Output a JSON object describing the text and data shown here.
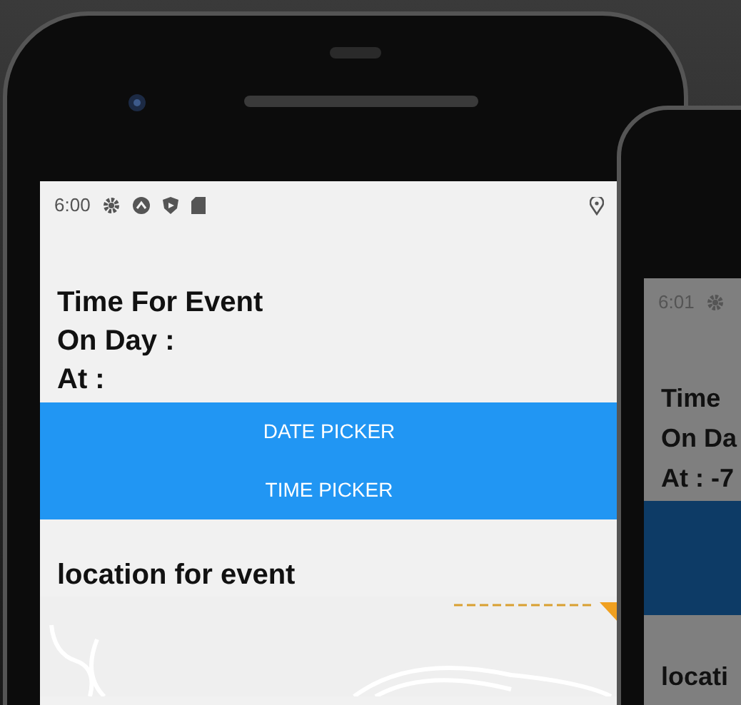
{
  "phones": [
    {
      "status_bar": {
        "time": "6:00"
      },
      "title": "Time For Event",
      "day_label": "On Day :",
      "time_label": "At :",
      "buttons": [
        "DATE PICKER",
        "TIME PICKER"
      ],
      "location_title": "location for event",
      "dimmed": false
    },
    {
      "status_bar": {
        "time": "6:01"
      },
      "title": "Time",
      "day_label": "On Da",
      "time_label": "At : -7",
      "location_title": "locati",
      "dimmed": true
    }
  ]
}
